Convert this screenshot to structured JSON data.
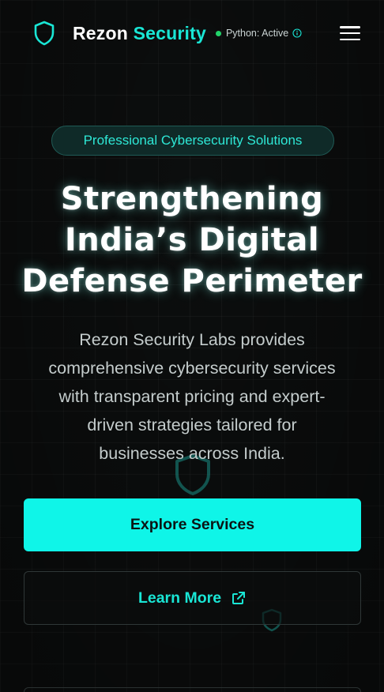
{
  "header": {
    "brand_primary": "Rezon",
    "brand_accent": "Security",
    "status_text": "Python: Active",
    "icons": {
      "logo": "shield-icon",
      "info": "info-icon",
      "menu": "hamburger-menu-icon"
    }
  },
  "hero": {
    "badge": "Professional Cybersecurity Solutions",
    "title_lines": [
      "Strengthening",
      "India’s Digital",
      "Defense Perimeter"
    ],
    "description_lines": [
      "Rezon Security Labs provides",
      "comprehensive cybersecurity services",
      "with transparent pricing and expert-",
      "driven strategies tailored for",
      "businesses across India."
    ]
  },
  "actions": {
    "primary_label": "Explore Services",
    "secondary_label": "Learn More",
    "secondary_icon": "external-link-icon"
  },
  "colors": {
    "background": "#0c0e0e",
    "accent": "#19e6d5",
    "primary_button": "#0ff5e8",
    "status_dot": "#22d36a"
  }
}
